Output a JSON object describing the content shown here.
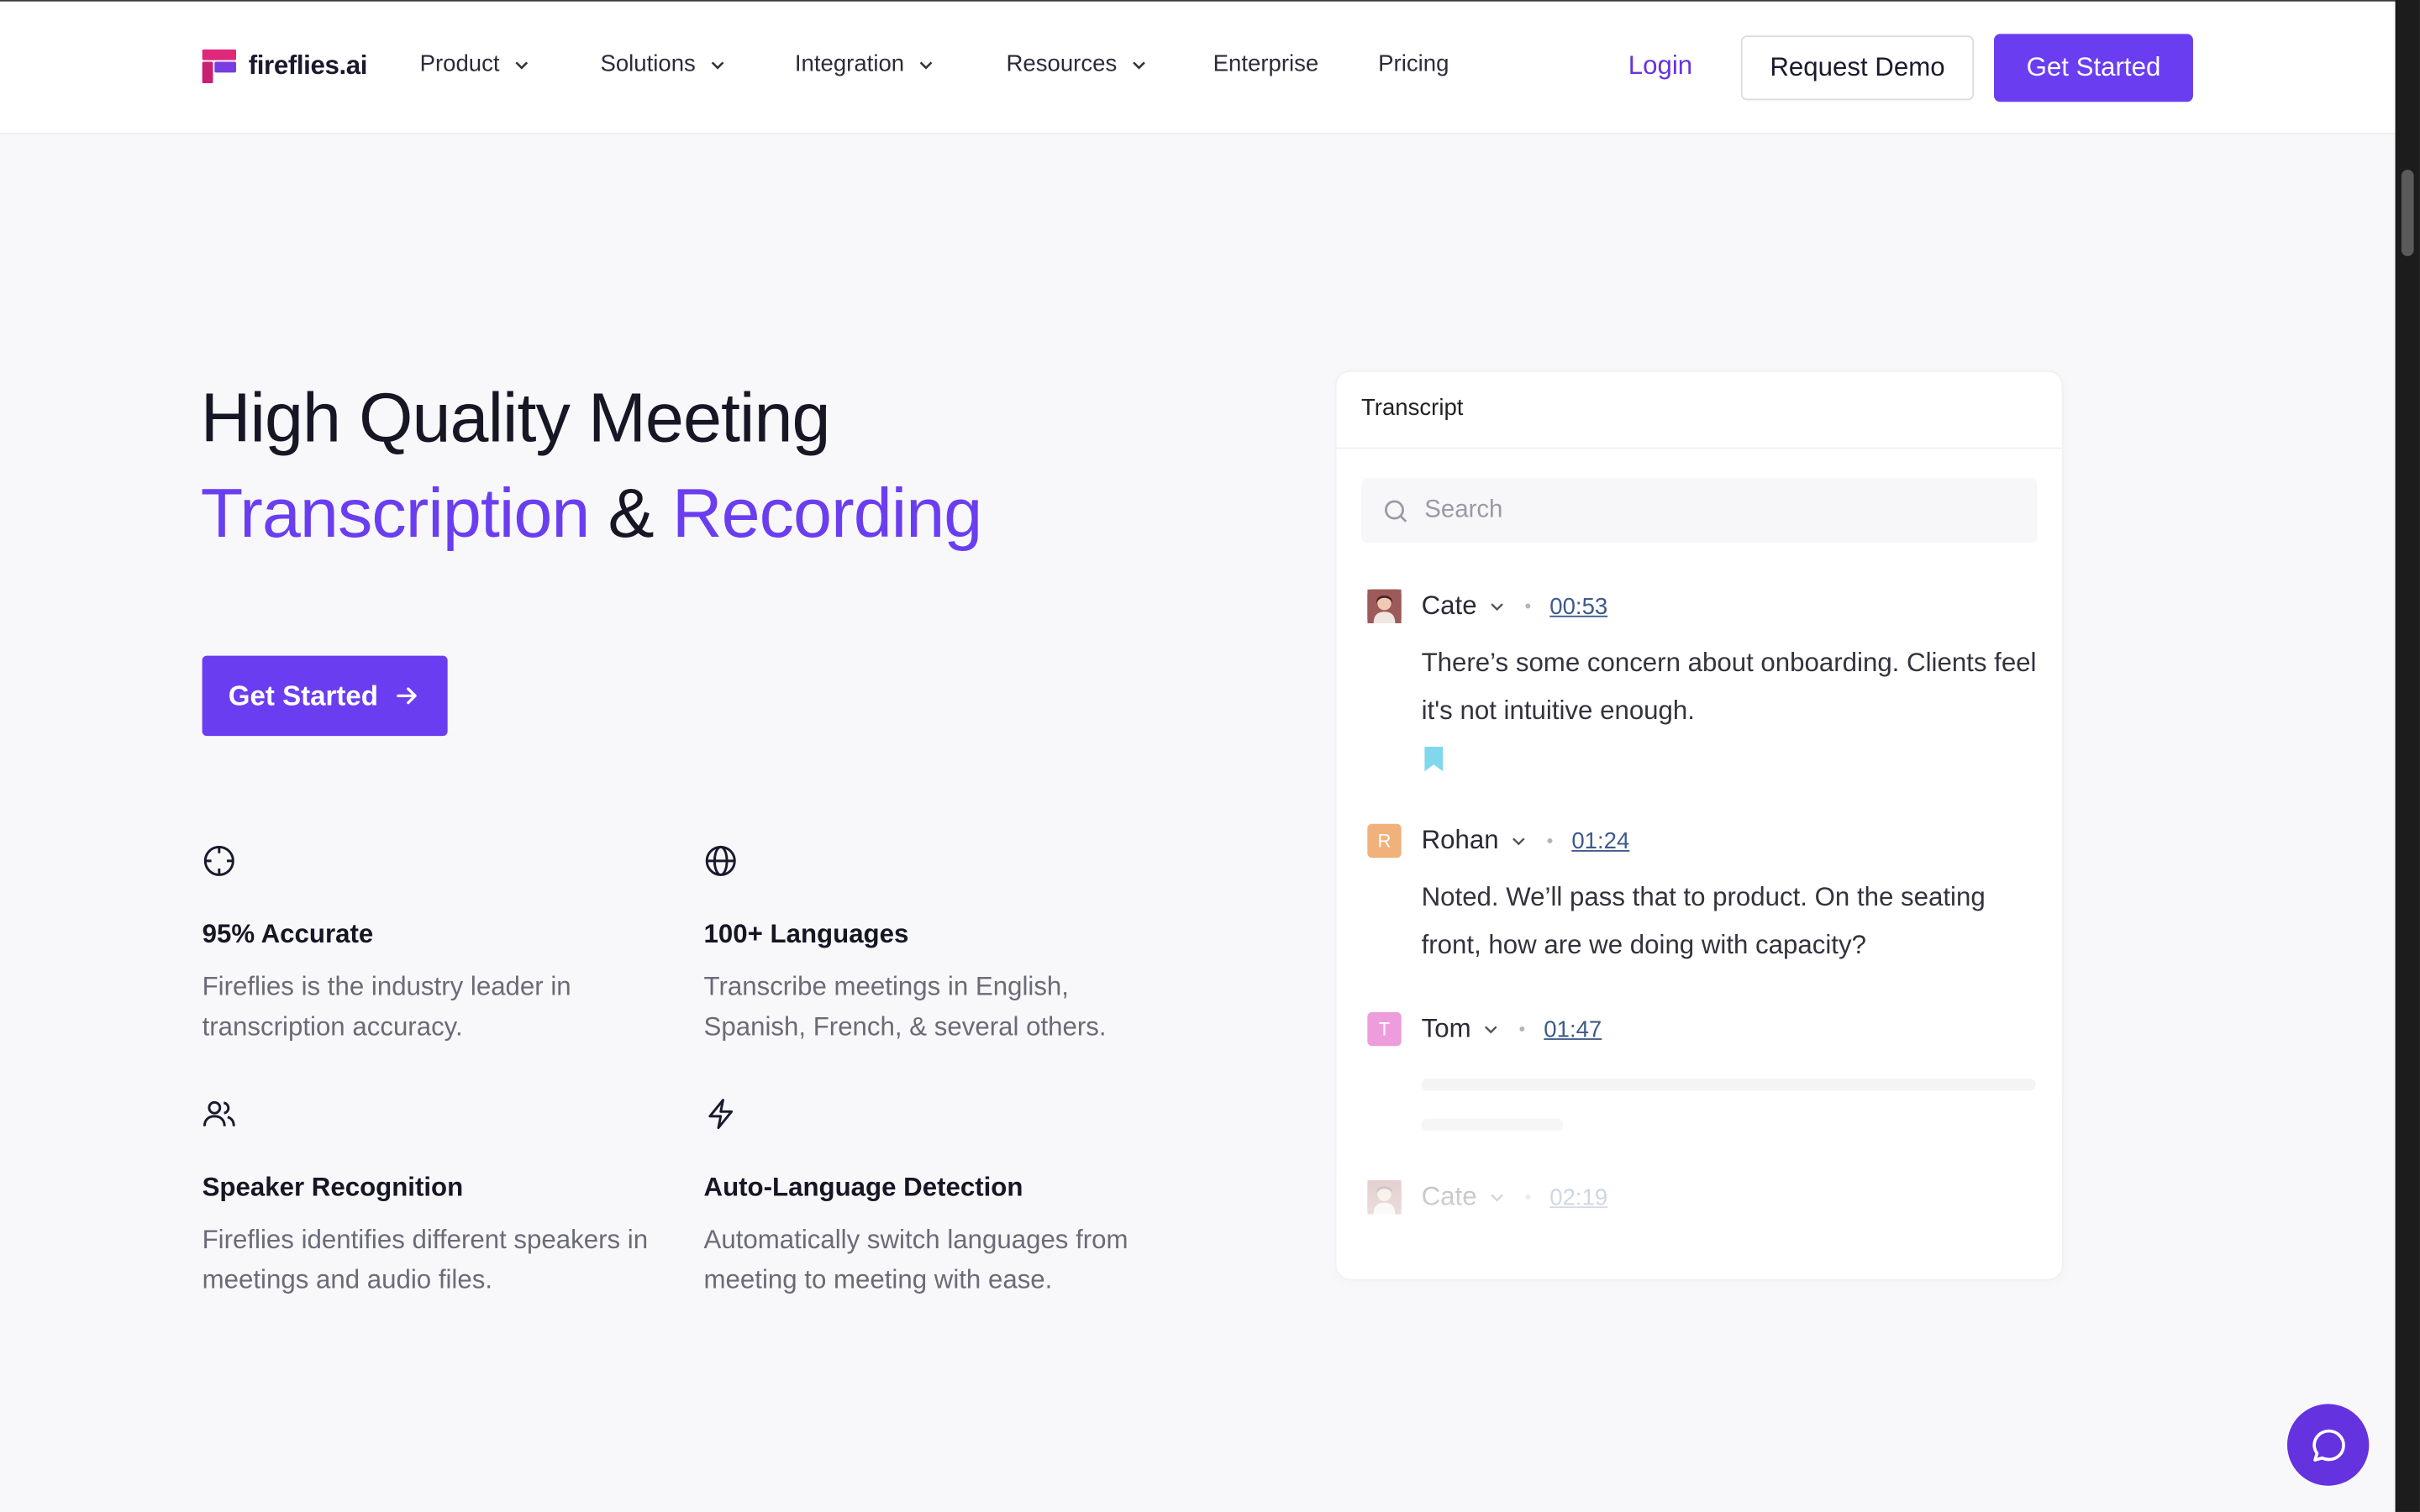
{
  "header": {
    "logo_text": "fireflies.ai",
    "nav": [
      {
        "label": "Product",
        "has_dropdown": true
      },
      {
        "label": "Solutions",
        "has_dropdown": true
      },
      {
        "label": "Integration",
        "has_dropdown": true
      },
      {
        "label": "Resources",
        "has_dropdown": true
      },
      {
        "label": "Enterprise",
        "has_dropdown": false
      },
      {
        "label": "Pricing",
        "has_dropdown": false
      }
    ],
    "login_label": "Login",
    "demo_label": "Request Demo",
    "start_label": "Get Started"
  },
  "hero": {
    "title_line1": "High Quality Meeting",
    "title_word1": "Transcription",
    "title_amp": "&",
    "title_word2": "Recording",
    "cta_label": "Get Started"
  },
  "features": [
    {
      "icon": "crosshair-icon",
      "title": "95% Accurate",
      "desc": "Fireflies is the industry leader in transcription accuracy."
    },
    {
      "icon": "globe-icon",
      "title": "100+ Languages",
      "desc": "Transcribe meetings in English, Spanish, French, & several others."
    },
    {
      "icon": "users-icon",
      "title": "Speaker Recognition",
      "desc": "Fireflies identifies different speakers in meetings and audio files."
    },
    {
      "icon": "lightning-icon",
      "title": "Auto-Language Detection",
      "desc": "Automatically switch languages from meeting to meeting with ease."
    }
  ],
  "transcript": {
    "title": "Transcript",
    "search_placeholder": "Search",
    "entries": [
      {
        "speaker": "Cate",
        "avatar": "photo",
        "time": "00:53",
        "text": "There’s some concern about onboarding. Clients feel it's not intuitive enough.",
        "bookmarked": true
      },
      {
        "speaker": "Rohan",
        "avatar": "R",
        "avatar_color": "#f0b27a",
        "time": "01:24",
        "text": "Noted. We’ll pass that to product. On the seating front, how are we doing with capacity?"
      },
      {
        "speaker": "Tom",
        "avatar": "T",
        "avatar_color": "#ee9ddc",
        "time": "01:47",
        "text": ""
      },
      {
        "speaker": "Cate",
        "avatar": "photo",
        "time": "02:19",
        "text": ""
      }
    ]
  },
  "colors": {
    "accent": "#6a3ef0",
    "timestamp": "#3d5a8a",
    "bookmark": "#7fd8ec"
  }
}
